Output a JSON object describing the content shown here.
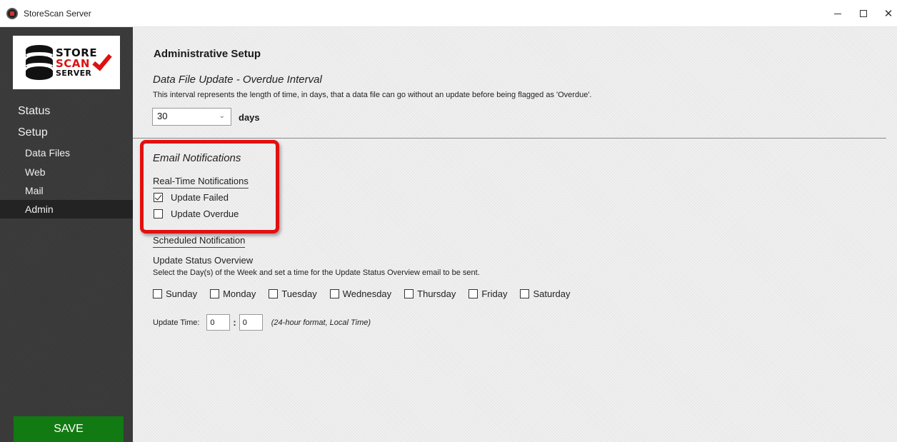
{
  "window": {
    "title": "StoreScan Server",
    "controls": {
      "minimize": "–",
      "maximize": "□",
      "close": "✕"
    }
  },
  "logo": {
    "line1": "STORE",
    "line2": "SCAN",
    "line3": "SERVER"
  },
  "sidebar": {
    "status_label": "Status",
    "setup_label": "Setup",
    "sub_items": [
      {
        "label": "Data Files",
        "selected": false
      },
      {
        "label": "Web",
        "selected": false
      },
      {
        "label": "Mail",
        "selected": false
      },
      {
        "label": "Admin",
        "selected": true
      }
    ],
    "save_label": "SAVE"
  },
  "main": {
    "title": "Administrative Setup",
    "overdue": {
      "title": "Data File Update - Overdue Interval",
      "description": "This interval represents the length of time, in days, that a data file can go without an update before being flagged as 'Overdue'.",
      "value": "30",
      "unit": "days"
    },
    "email": {
      "title": "Email Notifications",
      "realtime_heading": "Real-Time Notifications",
      "realtime_options": [
        {
          "label": "Update Failed",
          "checked": true
        },
        {
          "label": "Update Overdue",
          "checked": false
        }
      ],
      "scheduled_heading": "Scheduled Notification",
      "overview_title": "Update Status Overview",
      "overview_desc": "Select the Day(s) of the Week and set a time for the Update Status Overview email to be sent.",
      "days": [
        {
          "label": "Sunday",
          "checked": false
        },
        {
          "label": "Monday",
          "checked": false
        },
        {
          "label": "Tuesday",
          "checked": false
        },
        {
          "label": "Wednesday",
          "checked": false
        },
        {
          "label": "Thursday",
          "checked": false
        },
        {
          "label": "Friday",
          "checked": false
        },
        {
          "label": "Saturday",
          "checked": false
        }
      ],
      "time_label": "Update Time:",
      "hour": "0",
      "minute": "0",
      "time_separator": ":",
      "time_note": "(24-hour format, Local Time)"
    }
  },
  "colors": {
    "sidebar_bg": "#3a3a3a",
    "admin_selected_bg": "#232323",
    "save_button": "#127a12",
    "highlight_border": "#e31010",
    "logo_accent": "#dd1111"
  },
  "icons": [
    "app-icon",
    "chevron-down-icon",
    "checkmark-icon",
    "database-icon"
  ]
}
